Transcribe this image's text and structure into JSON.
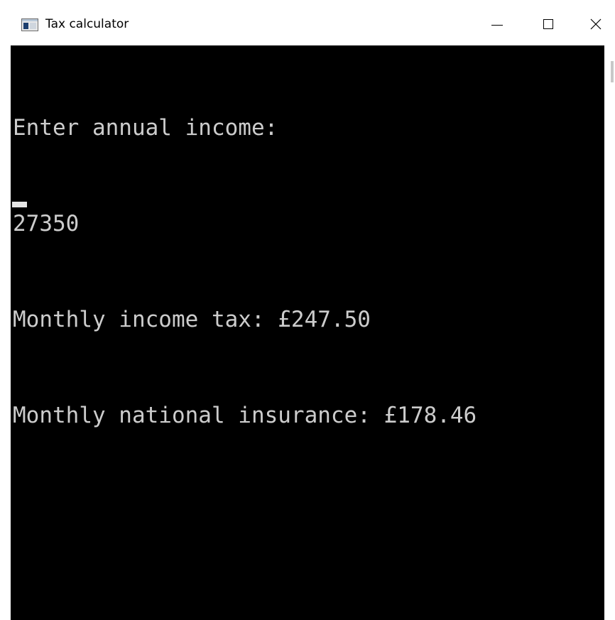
{
  "window": {
    "title": "Tax calculator",
    "icon": "console-app-icon",
    "controls": {
      "minimize_icon": "minimize-icon",
      "maximize_icon": "maximize-icon",
      "close_icon": "close-icon"
    }
  },
  "console": {
    "background": "#000000",
    "foreground": "#cccccc",
    "lines": [
      "Enter annual income:",
      "27350",
      "Monthly income tax: £247.50",
      "Monthly national insurance: £178.46"
    ]
  }
}
